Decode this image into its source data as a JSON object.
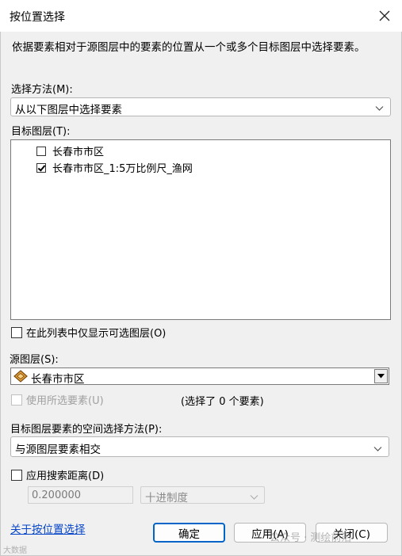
{
  "dialog": {
    "title": "按位置选择",
    "description": "依据要素相对于源图层中的要素的位置从一个或多个目标图层中选择要素。"
  },
  "selection_method": {
    "label": "选择方法(M):",
    "value": "从以下图层中选择要素"
  },
  "target_layers": {
    "label": "目标图层(T):",
    "items": [
      {
        "label": "长春市市区",
        "checked": false
      },
      {
        "label": "长春市市区_1:5万比例尺_渔网",
        "checked": true
      }
    ]
  },
  "only_selectable": {
    "label": "在此列表中仅显示可选图层(O)",
    "checked": false
  },
  "source_layer": {
    "label": "源图层(S):",
    "value": "长春市市区",
    "use_selected_label": "使用所选要素(U)",
    "selected_count_text": "(选择了 0 个要素)"
  },
  "spatial_method": {
    "label": "目标图层要素的空间选择方法(P):",
    "value": "与源图层要素相交"
  },
  "search_distance": {
    "label": "应用搜索距离(D)",
    "checked": false,
    "value": "0.200000",
    "unit": "十进制度"
  },
  "footer": {
    "help_link": "关于按位置选择",
    "ok_label": "确定",
    "apply_label": "应用(A)",
    "close_label": "关闭(C)"
  },
  "watermark": {
    "left_text": "大数据",
    "right_text": "公众号 · 测绘前沿"
  },
  "colors": {
    "link": "#0645c8",
    "primary_border": "#0064c8",
    "background": "#f0f0f0"
  }
}
